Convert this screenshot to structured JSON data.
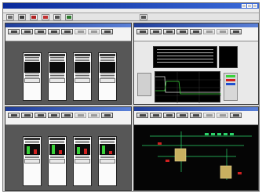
{
  "window": {
    "title": ""
  },
  "menu": [
    "",
    "",
    "",
    "",
    "",
    ""
  ],
  "toolbar_count": 7,
  "panes": [
    {
      "id": "top-left",
      "title": ""
    },
    {
      "id": "top-right",
      "title": ""
    },
    {
      "id": "bottom-left",
      "title": ""
    },
    {
      "id": "bottom-right",
      "title": ""
    }
  ],
  "colors": {
    "titlebar": "#0a2a9a",
    "pane_bg": "#575757",
    "trend_bg": "#000000",
    "network_green": "#2bd26a",
    "alarm_red": "#d02020",
    "level_green": "#38d038"
  }
}
